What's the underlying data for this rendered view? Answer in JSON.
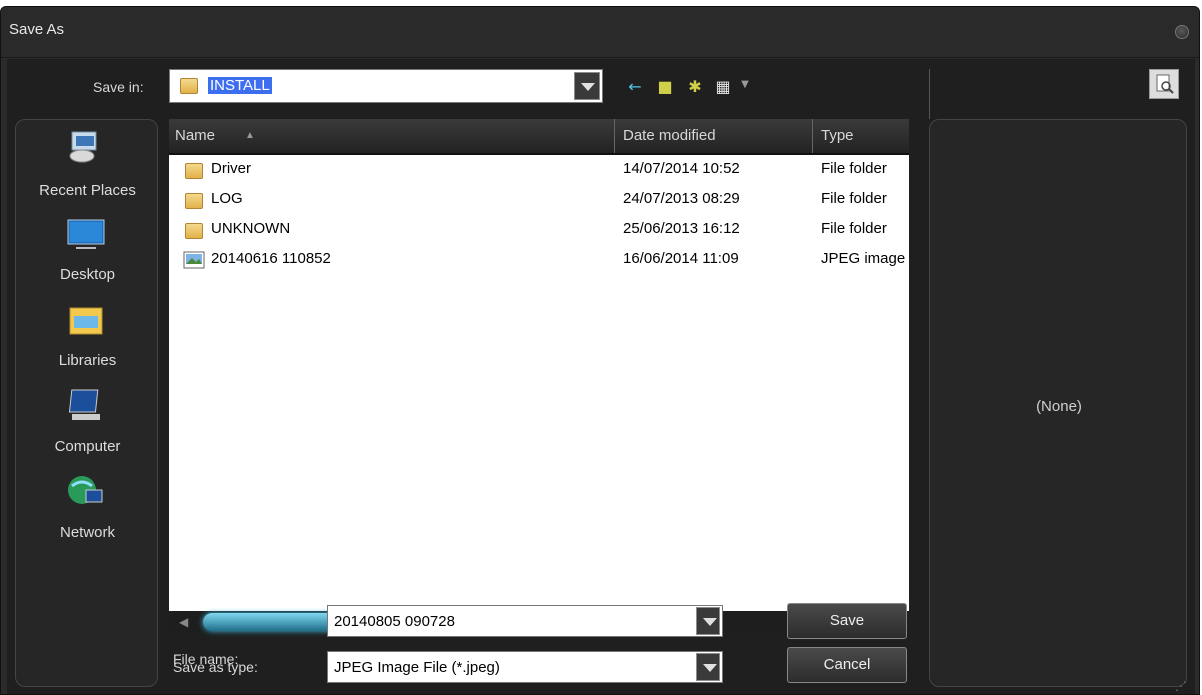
{
  "window": {
    "title": "Save As"
  },
  "savein": {
    "label": "Save in:",
    "value": "INSTALL"
  },
  "places": [
    {
      "label": "Recent Places",
      "icon": "recent-places-icon"
    },
    {
      "label": "Desktop",
      "icon": "desktop-icon"
    },
    {
      "label": "Libraries",
      "icon": "libraries-icon"
    },
    {
      "label": "Computer",
      "icon": "computer-icon"
    },
    {
      "label": "Network",
      "icon": "network-icon"
    }
  ],
  "columns": {
    "name": "Name",
    "date": "Date modified",
    "type": "Type"
  },
  "files": [
    {
      "name": "Driver",
      "date": "14/07/2014 10:52",
      "type": "File folder",
      "icon": "folder-icon"
    },
    {
      "name": "LOG",
      "date": "24/07/2013 08:29",
      "type": "File folder",
      "icon": "folder-icon"
    },
    {
      "name": "UNKNOWN",
      "date": "25/06/2013 16:12",
      "type": "File folder",
      "icon": "folder-icon"
    },
    {
      "name": "20140616 110852",
      "date": "16/06/2014 11:09",
      "type": "JPEG image",
      "icon": "image-file-icon"
    }
  ],
  "filename": {
    "label": "File name:",
    "value": "20140805 090728"
  },
  "savetype": {
    "label": "Save as type:",
    "value": "JPEG Image File (*.jpeg)"
  },
  "buttons": {
    "save": "Save",
    "cancel": "Cancel"
  },
  "preview": {
    "text": "(None)"
  }
}
